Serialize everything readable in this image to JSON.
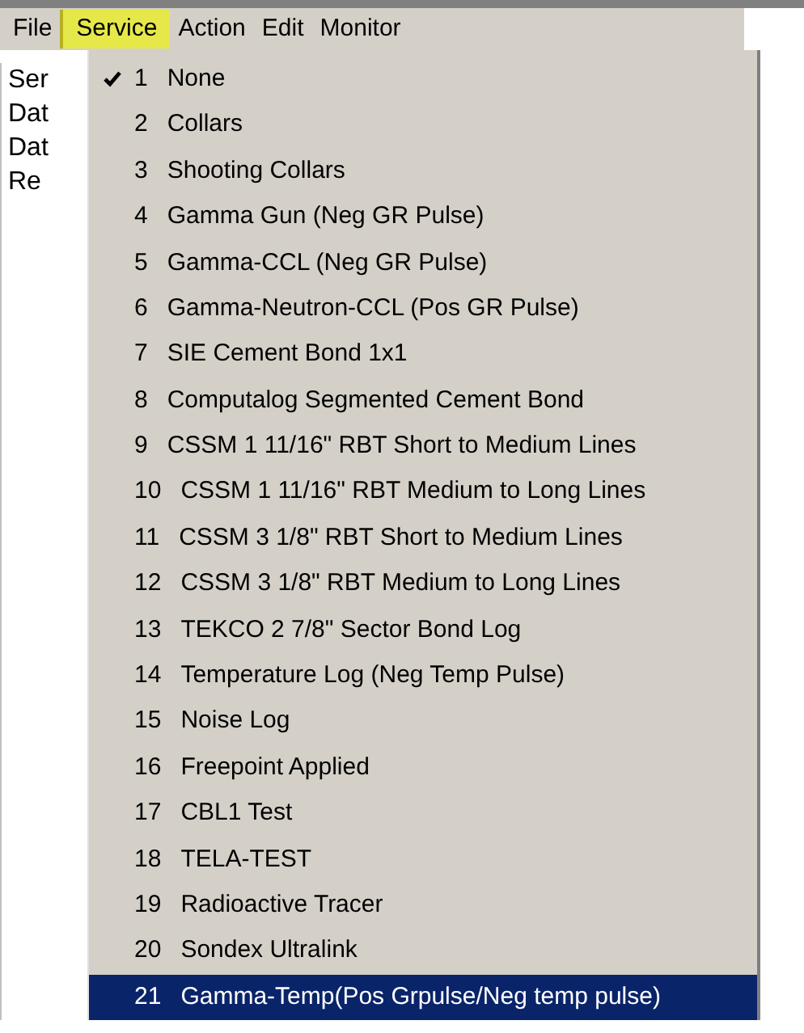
{
  "menubar": [
    {
      "label": "File",
      "selected": false
    },
    {
      "label": "Service",
      "selected": true
    },
    {
      "label": "Action",
      "selected": false
    },
    {
      "label": "Edit",
      "selected": false
    },
    {
      "label": "Monitor",
      "selected": false
    }
  ],
  "panel_labels": [
    "Ser",
    "Dat",
    "Dat",
    "Re"
  ],
  "service_menu": [
    {
      "number": "1",
      "label": "None",
      "checked": true,
      "selected": false
    },
    {
      "number": "2",
      "label": "Collars",
      "checked": false,
      "selected": false
    },
    {
      "number": "3",
      "label": "Shooting Collars",
      "checked": false,
      "selected": false
    },
    {
      "number": "4",
      "label": "Gamma Gun (Neg GR Pulse)",
      "checked": false,
      "selected": false
    },
    {
      "number": "5",
      "label": "Gamma-CCL (Neg GR Pulse)",
      "checked": false,
      "selected": false
    },
    {
      "number": "6",
      "label": "Gamma-Neutron-CCL (Pos GR Pulse)",
      "checked": false,
      "selected": false
    },
    {
      "number": "7",
      "label": "SIE Cement Bond 1x1",
      "checked": false,
      "selected": false
    },
    {
      "number": "8",
      "label": "Computalog Segmented Cement Bond",
      "checked": false,
      "selected": false
    },
    {
      "number": "9",
      "label": "CSSM 1 11/16\" RBT Short to Medium Lines",
      "checked": false,
      "selected": false
    },
    {
      "number": "10",
      "label": "CSSM 1 11/16\" RBT Medium to Long Lines",
      "checked": false,
      "selected": false
    },
    {
      "number": "11",
      "label": "CSSM 3 1/8\" RBT Short to Medium Lines",
      "checked": false,
      "selected": false
    },
    {
      "number": "12",
      "label": "CSSM 3 1/8\" RBT Medium to Long Lines",
      "checked": false,
      "selected": false
    },
    {
      "number": "13",
      "label": "TEKCO 2 7/8\" Sector Bond Log",
      "checked": false,
      "selected": false
    },
    {
      "number": "14",
      "label": "Temperature Log (Neg Temp Pulse)",
      "checked": false,
      "selected": false
    },
    {
      "number": "15",
      "label": "Noise Log",
      "checked": false,
      "selected": false
    },
    {
      "number": "16",
      "label": "Freepoint Applied",
      "checked": false,
      "selected": false
    },
    {
      "number": "17",
      "label": "CBL1 Test",
      "checked": false,
      "selected": false
    },
    {
      "number": "18",
      "label": "TELA-TEST",
      "checked": false,
      "selected": false
    },
    {
      "number": "19",
      "label": "Radioactive Tracer",
      "checked": false,
      "selected": false
    },
    {
      "number": "20",
      "label": "Sondex Ultralink",
      "checked": false,
      "selected": false
    },
    {
      "number": "21",
      "label": "Gamma-Temp(Pos Grpulse/Neg temp pulse)",
      "checked": false,
      "selected": true
    }
  ]
}
